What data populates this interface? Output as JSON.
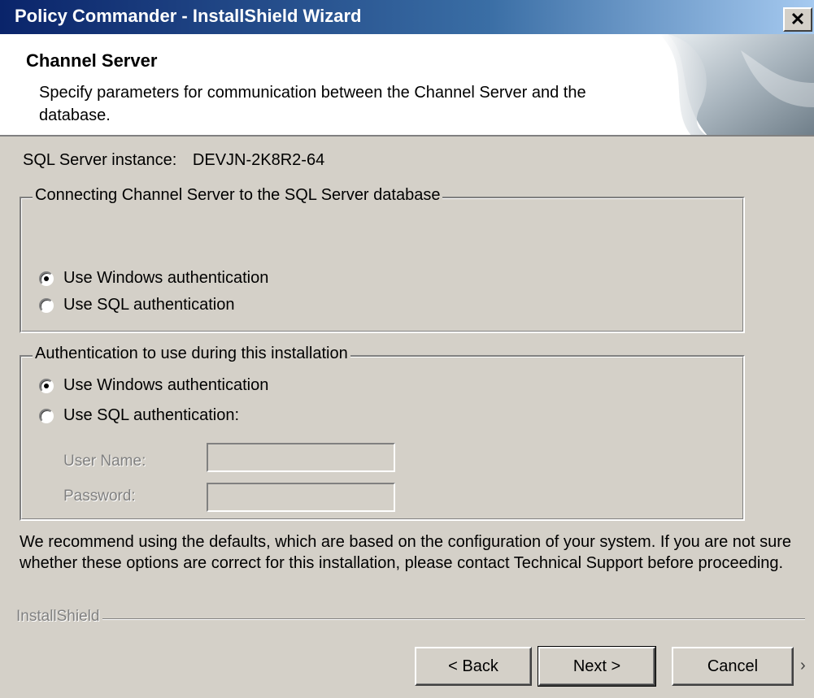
{
  "window": {
    "title": "Policy Commander - InstallShield Wizard",
    "close_glyph": "✕"
  },
  "header": {
    "title": "Channel Server",
    "subtitle": "Specify parameters for communication between the Channel Server and the database."
  },
  "instance": {
    "label": "SQL Server instance:",
    "value": "DEVJN-2K8R2-64"
  },
  "group1": {
    "legend": "Connecting Channel Server to the SQL Server database",
    "option_windows": "Use Windows authentication",
    "option_sql": "Use SQL authentication",
    "selected": "windows"
  },
  "group2": {
    "legend": "Authentication to use during this installation",
    "option_windows": "Use Windows authentication",
    "option_sql": "Use SQL authentication:",
    "selected": "windows",
    "username_label": "User Name:",
    "username_value": "",
    "password_label": "Password:",
    "password_value": ""
  },
  "note": "We recommend using the defaults, which are based on the configuration of your system. If you are not sure whether these options are correct for this installation, please contact Technical Support before proceeding.",
  "brand": "InstallShield",
  "buttons": {
    "back": "< Back",
    "next": "Next >",
    "cancel": "Cancel"
  },
  "colors": {
    "title_start": "#0a246a",
    "title_end": "#a6caf0",
    "dialog_bg": "#d4d0c8"
  },
  "icons": {
    "close": "close-icon",
    "resize": "resize-grip-icon"
  }
}
